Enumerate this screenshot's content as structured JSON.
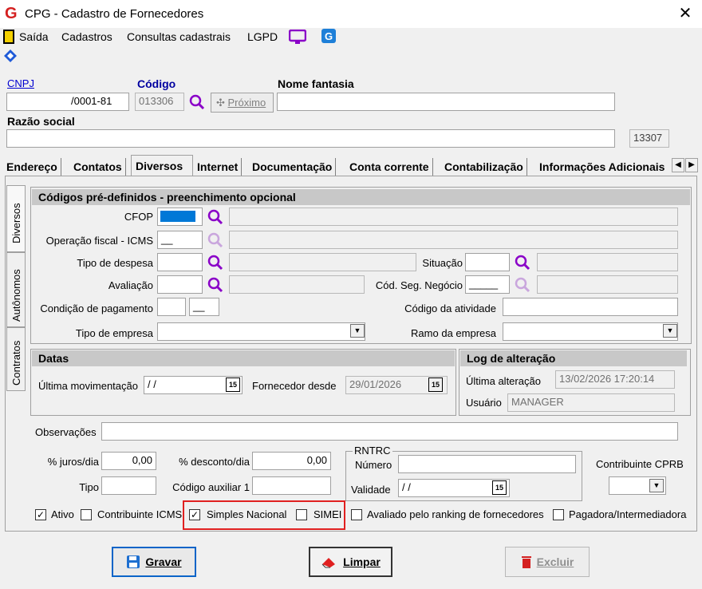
{
  "window": {
    "title": "CPG - Cadastro de Fornecedores"
  },
  "menu": {
    "items": [
      "Saída",
      "Cadastros",
      "Consultas cadastrais",
      "LGPD"
    ]
  },
  "header": {
    "cnpj_label": "CNPJ",
    "cnpj_value": "/0001-81",
    "codigo_label": "Código",
    "codigo_value": "013306",
    "proximo_label": "Próximo",
    "nome_fantasia_label": "Nome fantasia",
    "razao_social_label": "Razão social",
    "razao_code": "13307"
  },
  "tabs": [
    "Endereço",
    "Contatos",
    "Diversos",
    "Internet",
    "Documentação",
    "Conta corrente",
    "Contabilização",
    "Informações Adicionais"
  ],
  "side_tabs": [
    "Diversos",
    "Autônomos",
    "Contratos"
  ],
  "codigos": {
    "title": "Códigos pré-definidos - preenchimento opcional",
    "cfop": "CFOP",
    "operacao_fiscal": "Operação fiscal - ICMS",
    "operacao_value": "__",
    "tipo_despesa": "Tipo de despesa",
    "situacao": "Situação",
    "avaliacao": "Avaliação",
    "cod_seg_negocio": "Cód. Seg. Negócio",
    "cod_seg_value": "_____",
    "condicao_pagamento": "Condição de pagamento",
    "condicao_value2": "__",
    "codigo_atividade": "Código da atividade",
    "tipo_empresa": "Tipo de empresa",
    "ramo_empresa": "Ramo da empresa"
  },
  "datas": {
    "title": "Datas",
    "ultima_mov": "Última movimentação",
    "ultima_mov_value": " /  /",
    "fornecedor_desde": "Fornecedor desde",
    "fornecedor_desde_value": "29/01/2026"
  },
  "log": {
    "title": "Log de alteração",
    "ultima_alteracao": "Última alteração",
    "ultima_alteracao_value": "13/02/2026 17:20:14",
    "usuario": "Usuário",
    "usuario_value": "MANAGER"
  },
  "outros": {
    "observacoes": "Observações",
    "juros": "% juros/dia",
    "juros_value": "0,00",
    "desconto": "% desconto/dia",
    "desconto_value": "0,00",
    "tipo": "Tipo",
    "codigo_auxiliar": "Código auxiliar 1",
    "rntrc": "RNTRC",
    "numero": "Número",
    "validade": "Validade",
    "validade_value": " /  /",
    "contribuinte_cprb": "Contribuinte CPRB"
  },
  "checks": {
    "ativo": "Ativo",
    "contribuinte_icms": "Contribuinte ICMS",
    "simples_nacional": "Simples Nacional",
    "simei": "SIMEI",
    "avaliado": "Avaliado pelo ranking de fornecedores",
    "pagadora": "Pagadora/Intermediadora"
  },
  "buttons": {
    "gravar": "Gravar",
    "limpar": "Limpar",
    "excluir": "Excluir"
  },
  "colors": {
    "highlight_box": "#e02020",
    "icon_purple": "#8a00c8",
    "link_blue": "#0000d0"
  }
}
